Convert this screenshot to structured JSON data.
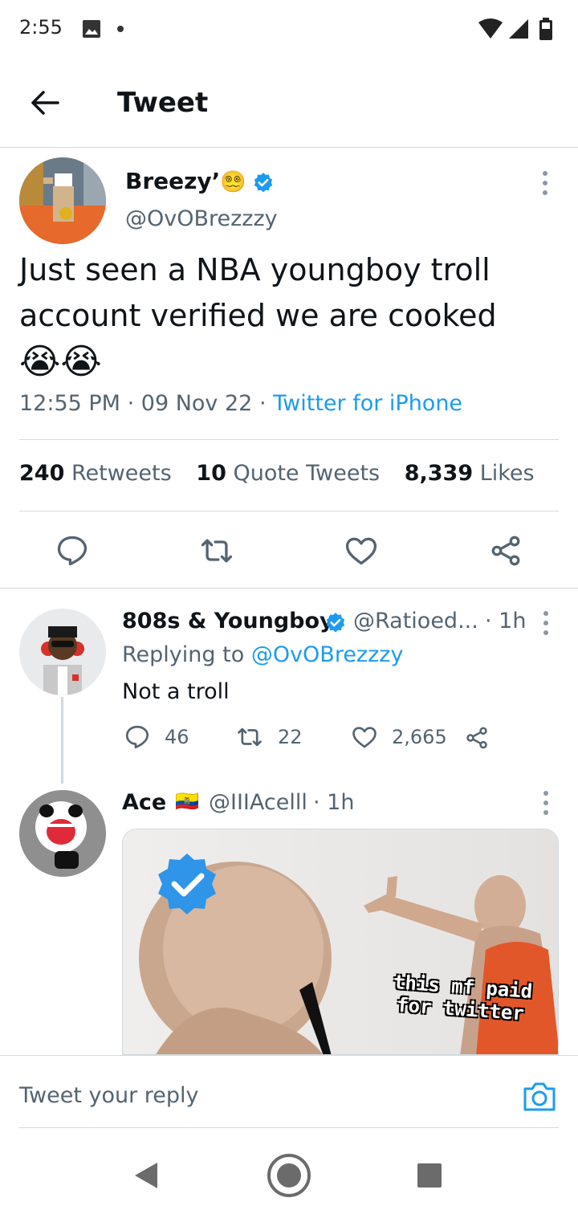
{
  "status_bar": {
    "time": "2:55",
    "icons": [
      "image-icon",
      "notification-dot-icon",
      "wifi-icon",
      "signal-icon",
      "battery-icon"
    ]
  },
  "header": {
    "title": "Tweet",
    "back_icon": "arrow-left-icon"
  },
  "main_tweet": {
    "author_name": "Breezy’",
    "author_emoji": "😵‍💫",
    "verified": true,
    "handle": "@OvOBrezzzy",
    "text": "Just seen a NBA youngboy troll account verified we are cooked",
    "emojis": "😭😭",
    "time": "12:55 PM",
    "separator": "·",
    "date": "09 Nov 22",
    "source": "Twitter for iPhone",
    "stats": {
      "retweets_count": "240",
      "retweets_label": "Retweets",
      "quotes_count": "10",
      "quotes_label": "Quote Tweets",
      "likes_count": "8,339",
      "likes_label": "Likes"
    },
    "actions": [
      "reply-icon",
      "retweet-icon",
      "like-icon",
      "share-icon"
    ]
  },
  "replies": [
    {
      "author_name": "808s & Youngboy",
      "verified": true,
      "handle": "@Ratioed...",
      "time": "· 1h",
      "replying_prefix": "Replying to",
      "replying_to": "@OvOBrezzzy",
      "text": "Not a troll",
      "reply_count": "46",
      "retweet_count": "22",
      "like_count": "2,665"
    },
    {
      "author_name": "Ace",
      "flag": "🇪🇨",
      "handle": "@IIIAcelll",
      "time": "· 1h",
      "media_caption_line1": "this mf paid",
      "media_caption_line2": "for twitter"
    }
  ],
  "composer": {
    "placeholder": "Tweet your reply",
    "camera_icon": "camera-icon"
  },
  "nav": {
    "icons": [
      "nav-back-icon",
      "nav-home-icon",
      "nav-recents-icon"
    ]
  },
  "colors": {
    "accent": "#1d9bf0",
    "secondary_text": "#536471",
    "divider": "#d4d9dd"
  }
}
